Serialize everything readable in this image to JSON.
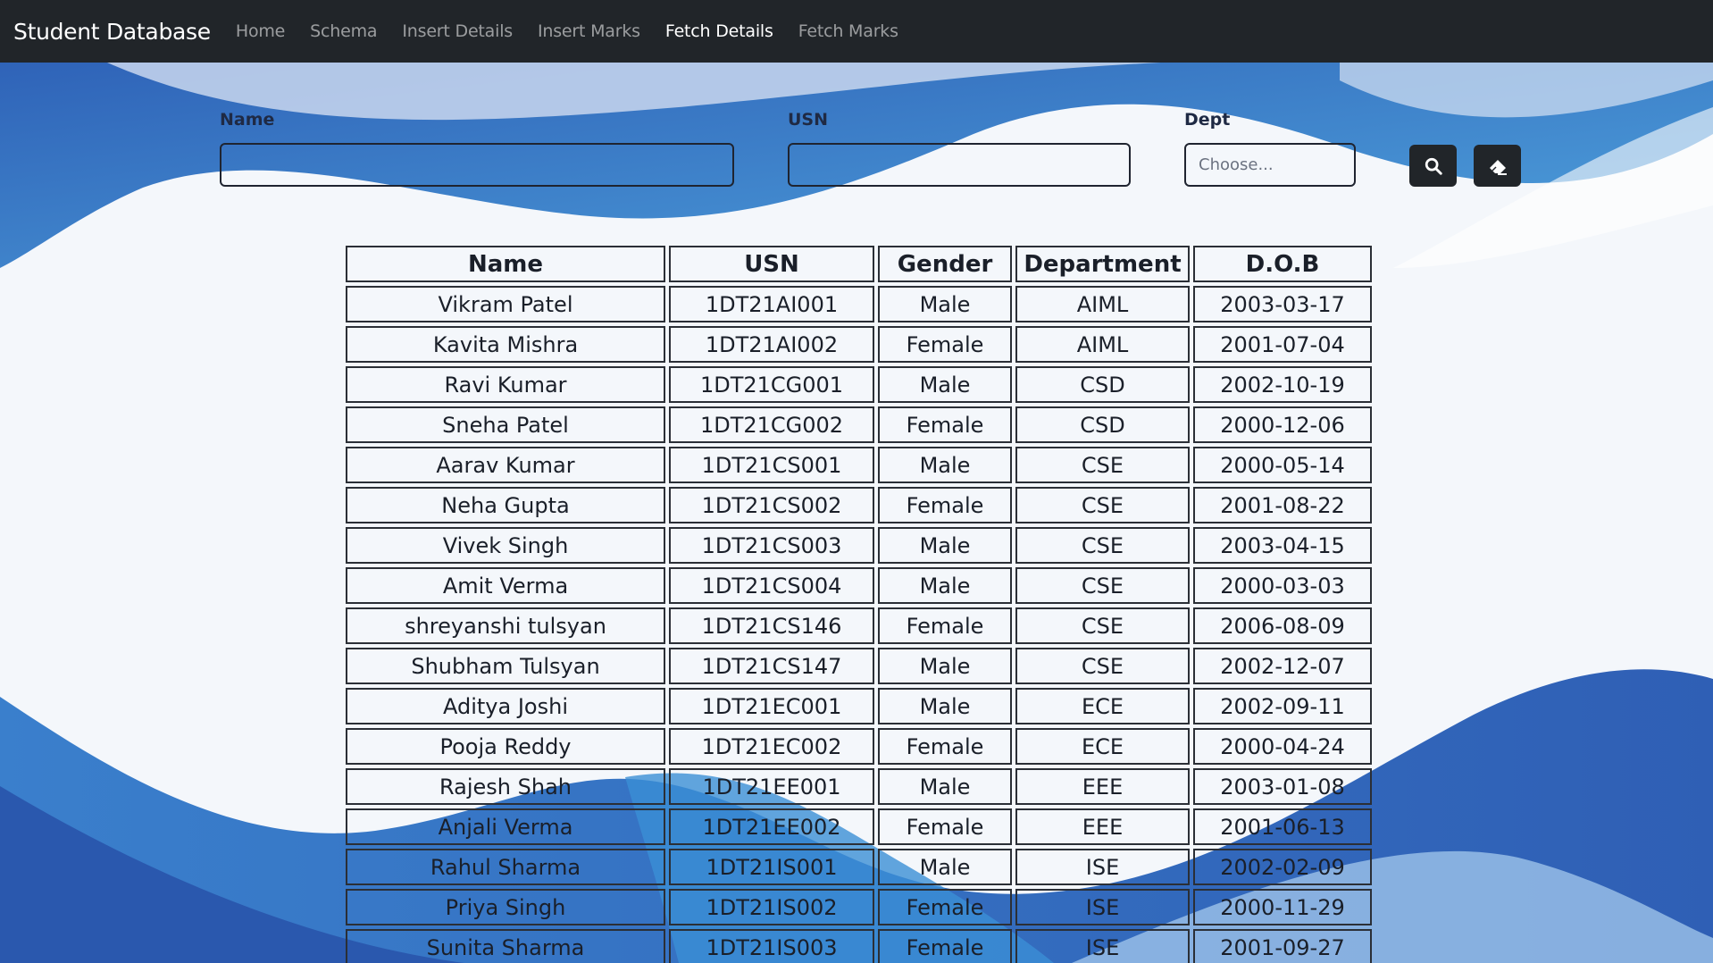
{
  "nav": {
    "brand": "Student Database",
    "links": [
      {
        "label": "Home",
        "active": false
      },
      {
        "label": "Schema",
        "active": false
      },
      {
        "label": "Insert Details",
        "active": false
      },
      {
        "label": "Insert Marks",
        "active": false
      },
      {
        "label": "Fetch Details",
        "active": true
      },
      {
        "label": "Fetch Marks",
        "active": false
      }
    ]
  },
  "form": {
    "name_label": "Name",
    "name_value": "",
    "usn_label": "USN",
    "usn_value": "",
    "dept_label": "Dept",
    "dept_placeholder": "Choose...",
    "search_icon": "search-icon",
    "clear_icon": "eraser-icon"
  },
  "colors": {
    "navbar": "#212529",
    "wave_dark": "#2f63b8",
    "wave_light": "#4fa3dd"
  },
  "table": {
    "headers": [
      "Name",
      "USN",
      "Gender",
      "Department",
      "D.O.B"
    ],
    "rows": [
      [
        "Vikram Patel",
        "1DT21AI001",
        "Male",
        "AIML",
        "2003-03-17"
      ],
      [
        "Kavita Mishra",
        "1DT21AI002",
        "Female",
        "AIML",
        "2001-07-04"
      ],
      [
        "Ravi Kumar",
        "1DT21CG001",
        "Male",
        "CSD",
        "2002-10-19"
      ],
      [
        "Sneha Patel",
        "1DT21CG002",
        "Female",
        "CSD",
        "2000-12-06"
      ],
      [
        "Aarav Kumar",
        "1DT21CS001",
        "Male",
        "CSE",
        "2000-05-14"
      ],
      [
        "Neha Gupta",
        "1DT21CS002",
        "Female",
        "CSE",
        "2001-08-22"
      ],
      [
        "Vivek Singh",
        "1DT21CS003",
        "Male",
        "CSE",
        "2003-04-15"
      ],
      [
        "Amit Verma",
        "1DT21CS004",
        "Male",
        "CSE",
        "2000-03-03"
      ],
      [
        "shreyanshi tulsyan",
        "1DT21CS146",
        "Female",
        "CSE",
        "2006-08-09"
      ],
      [
        "Shubham Tulsyan",
        "1DT21CS147",
        "Male",
        "CSE",
        "2002-12-07"
      ],
      [
        "Aditya Joshi",
        "1DT21EC001",
        "Male",
        "ECE",
        "2002-09-11"
      ],
      [
        "Pooja Reddy",
        "1DT21EC002",
        "Female",
        "ECE",
        "2000-04-24"
      ],
      [
        "Rajesh Shah",
        "1DT21EE001",
        "Male",
        "EEE",
        "2003-01-08"
      ],
      [
        "Anjali Verma",
        "1DT21EE002",
        "Female",
        "EEE",
        "2001-06-13"
      ],
      [
        "Rahul Sharma",
        "1DT21IS001",
        "Male",
        "ISE",
        "2002-02-09"
      ],
      [
        "Priya Singh",
        "1DT21IS002",
        "Female",
        "ISE",
        "2000-11-29"
      ],
      [
        "Sunita Sharma",
        "1DT21IS003",
        "Female",
        "ISE",
        "2001-09-27"
      ]
    ]
  }
}
